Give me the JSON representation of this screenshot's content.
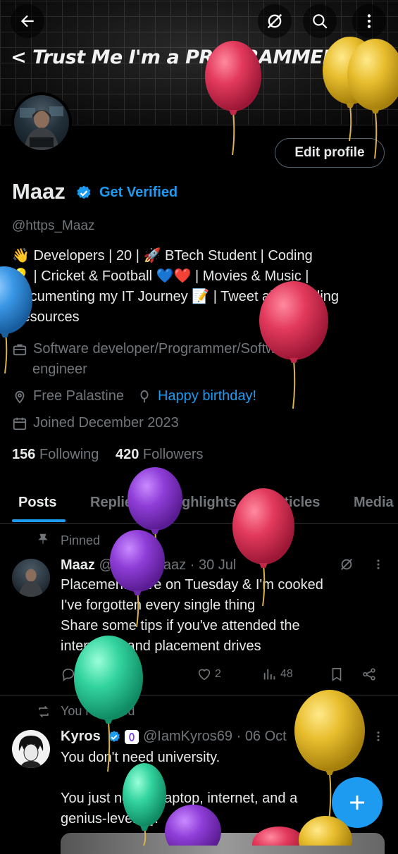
{
  "header": {
    "banner_title": "< Trust Me I'm a PROGRAMMER :) />",
    "icons": [
      "back-arrow-icon",
      "no-signal-icon",
      "search-icon",
      "more-vertical-icon"
    ]
  },
  "profile": {
    "edit_label": "Edit profile",
    "name": "Maaz",
    "get_verified": "Get Verified",
    "handle": "@https_Maaz",
    "bio_lines": [
      "👋 Developers | 20 | 🚀 BTech Student | Coding",
      "💡 | Cricket & Football 💙❤️ | Movies & Music |",
      "Documenting my IT Journey 📝 | Tweet abt - Coding",
      "Resources"
    ],
    "profession_line1": "Software developer/Programmer/Software",
    "profession_line2": "engineer",
    "location": "Free Palastine",
    "birthday": "Happy birthday!",
    "joined": "Joined December 2023",
    "following_count": "156",
    "following_label": "Following",
    "followers_count": "420",
    "followers_label": "Followers"
  },
  "tabs": [
    "Posts",
    "Replies",
    "Highlights",
    "Articles",
    "Media"
  ],
  "posts": [
    {
      "context": "Pinned",
      "author": "Maaz",
      "handle": "@https_Maaz",
      "dot": "·",
      "date": "30 Jul",
      "lines": [
        "Placement drive on Tuesday & I'm cooked",
        "I've forgotten every single thing",
        "Share some tips if you've attended the",
        "interviews and placement drives"
      ],
      "replies": "1",
      "likes": "2",
      "views": "48"
    },
    {
      "context": "You reposted",
      "author": "Kyros",
      "handle": "@IamKyros69",
      "dot": "·",
      "date": "06 Oct",
      "lines": [
        "You don't need university.",
        "",
        "You just need a laptop, internet, and a",
        "genius-level IQ."
      ]
    }
  ],
  "colors": {
    "accent": "#1d9bf0",
    "muted": "#71767b",
    "text": "#e7e9ea",
    "background": "#000000",
    "divider": "#2f3336"
  }
}
